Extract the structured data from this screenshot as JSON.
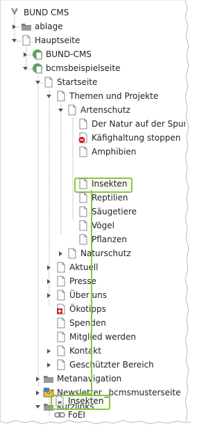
{
  "tree": {
    "root": {
      "label": "BUND CMS"
    },
    "items": [
      {
        "label": "ablage"
      },
      {
        "label": "Hauptseite"
      },
      {
        "label": "BUND-CMS"
      },
      {
        "label": "bcmsbeispielseite"
      },
      {
        "label": "Startseite"
      },
      {
        "label": "Themen und Projekte"
      },
      {
        "label": "Artenschutz"
      },
      {
        "label": "Der Natur auf der Spur"
      },
      {
        "label": "Käfighaltung stoppen"
      },
      {
        "label": "Amphibien"
      },
      {
        "label": "Insekten"
      },
      {
        "label": "Reptilien"
      },
      {
        "label": "Säugetiere"
      },
      {
        "label": "Vögel"
      },
      {
        "label": "Pflanzen"
      },
      {
        "label": "Naturschutz"
      },
      {
        "label": "Aktuell"
      },
      {
        "label": "Presse"
      },
      {
        "label": "Über uns"
      },
      {
        "label": "Ökotipps"
      },
      {
        "label": "Spenden"
      },
      {
        "label": "Mitglied werden"
      },
      {
        "label": "Kontakt"
      },
      {
        "label": "Geschützter Bereich"
      },
      {
        "label": "Metanavigation"
      },
      {
        "label": "Newsletter _bcmsmusterseite"
      },
      {
        "label": "Kurzlinks"
      },
      {
        "label": "Insekten"
      },
      {
        "label": "FoEI"
      }
    ]
  },
  "colors": {
    "highlight": "#8cc53f",
    "folder": "#707070",
    "page_icon": "#8a8a8a",
    "link_icon": "#4a7fc1",
    "error_badge": "#cc2222",
    "site_badge": "#3aa53a"
  }
}
